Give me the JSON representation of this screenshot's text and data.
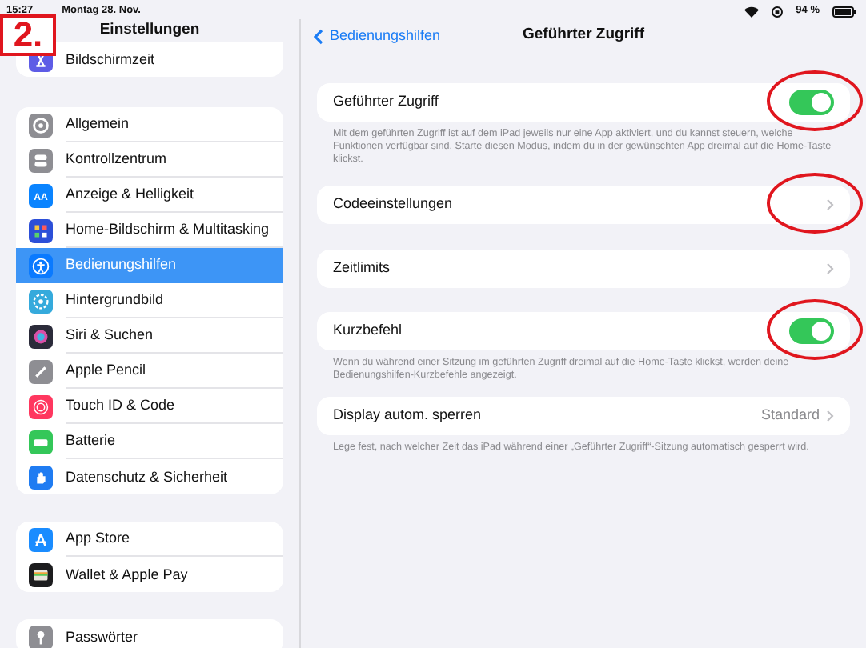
{
  "status_bar": {
    "time": "15:27",
    "date": "Montag 28. Nov.",
    "battery": "94 %"
  },
  "step_marker": "2.",
  "sidebar": {
    "title": "Einstellungen",
    "groups": [
      {
        "items": [
          {
            "label": "Bildschirmzeit",
            "color": "#5e5ce6",
            "selected": false
          }
        ]
      },
      {
        "items": [
          {
            "label": "Allgemein",
            "color": "#8e8e93",
            "selected": false
          },
          {
            "label": "Kontrollzentrum",
            "color": "#8e8e93",
            "selected": false
          },
          {
            "label": "Anzeige & Helligkeit",
            "color": "#0a84ff",
            "selected": false,
            "icon_text": "AA"
          },
          {
            "label": "Home-Bildschirm & Multitasking",
            "color": "#2c4fd8",
            "selected": false
          },
          {
            "label": "Bedienungshilfen",
            "color": "#0a7aff",
            "selected": true
          },
          {
            "label": "Hintergrundbild",
            "color": "#35aadc",
            "selected": false
          },
          {
            "label": "Siri & Suchen",
            "color": "#2b2b3a",
            "selected": false
          },
          {
            "label": "Apple Pencil",
            "color": "#8e8e93",
            "selected": false
          },
          {
            "label": "Touch ID & Code",
            "color": "#ff375f",
            "selected": false
          },
          {
            "label": "Batterie",
            "color": "#34c759",
            "selected": false
          },
          {
            "label": "Datenschutz & Sicherheit",
            "color": "#1f7cf2",
            "selected": false
          }
        ]
      },
      {
        "items": [
          {
            "label": "App Store",
            "color": "#1a8cff",
            "selected": false
          },
          {
            "label": "Wallet & Apple Pay",
            "color": "#1c1c1e",
            "selected": false
          }
        ]
      },
      {
        "items": [
          {
            "label": "Passwörter",
            "color": "#8e8e93",
            "selected": false
          }
        ]
      }
    ]
  },
  "detail": {
    "back": "Bedienungshilfen",
    "title": "Geführter Zugriff",
    "sections": [
      {
        "rows": [
          {
            "kind": "toggle",
            "label": "Geführter Zugriff",
            "on": true,
            "circled": true
          }
        ],
        "footer": "Mit dem geführten Zugriff ist auf dem iPad jeweils nur eine App aktiviert, und du kannst steuern, welche Funktionen verfügbar sind. Starte diesen Modus, indem du in der gewünschten App dreimal auf die Home-Taste klickst."
      },
      {
        "rows": [
          {
            "kind": "link",
            "label": "Codeeinstellungen",
            "circled": true
          }
        ]
      },
      {
        "rows": [
          {
            "kind": "link",
            "label": "Zeitlimits",
            "circled": false
          }
        ]
      },
      {
        "rows": [
          {
            "kind": "toggle",
            "label": "Kurzbefehl",
            "on": true,
            "circled": true
          }
        ],
        "footer": "Wenn du während einer Sitzung im geführten Zugriff dreimal auf die Home-Taste klickst, werden deine Bedienungshilfen-Kurzbefehle angezeigt."
      },
      {
        "rows": [
          {
            "kind": "link",
            "label": "Display autom. sperren",
            "value": "Standard",
            "circled": false
          }
        ],
        "footer": "Lege fest, nach welcher Zeit das iPad während einer „Geführter Zugriff“-Sitzung automatisch gesperrt wird."
      }
    ]
  }
}
